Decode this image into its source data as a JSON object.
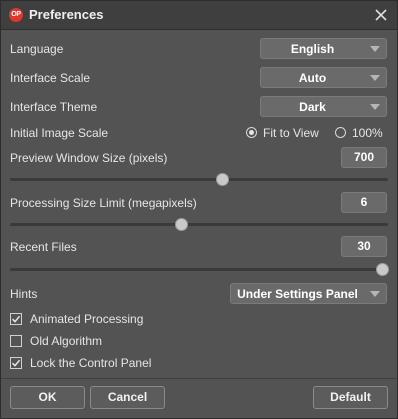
{
  "window": {
    "title": "Preferences",
    "logo_text": "OP"
  },
  "language": {
    "label": "Language",
    "value": "English"
  },
  "interface_scale": {
    "label": "Interface Scale",
    "value": "Auto"
  },
  "interface_theme": {
    "label": "Interface Theme",
    "value": "Dark"
  },
  "initial_image_scale": {
    "label": "Initial Image Scale",
    "options": [
      "Fit to View",
      "100%"
    ],
    "selected": "Fit to View"
  },
  "preview_window_size": {
    "label": "Preview Window Size (pixels)",
    "value": "700",
    "slider_fraction": 0.57
  },
  "processing_size_limit": {
    "label": "Processing Size Limit (megapixels)",
    "value": "6",
    "slider_fraction": 0.46
  },
  "recent_files": {
    "label": "Recent Files",
    "value": "30",
    "slider_fraction": 1.0
  },
  "hints": {
    "label": "Hints",
    "value": "Under Settings Panel"
  },
  "checkboxes": [
    {
      "label": "Animated Processing",
      "checked": true
    },
    {
      "label": "Old Algorithm",
      "checked": false
    },
    {
      "label": "Lock the Control Panel",
      "checked": true
    }
  ],
  "buttons": {
    "ok": "OK",
    "cancel": "Cancel",
    "default": "Default"
  },
  "icons": {
    "close": "close-icon",
    "dropdown": "chevron-down-icon",
    "check": "checkmark-icon"
  },
  "colors": {
    "background": "#535353",
    "titlebar": "#3f3f3f",
    "logo": "#d63b2f"
  }
}
